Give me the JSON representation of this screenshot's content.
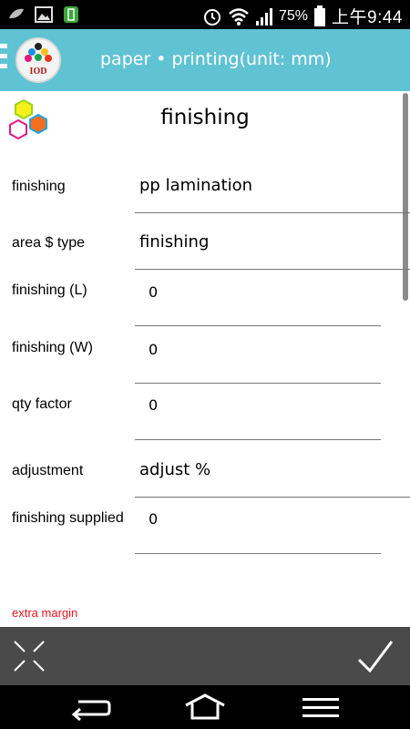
{
  "statusbar": {
    "battery_pct": "75%",
    "time": "上午9:44",
    "icons": [
      "leaf-icon",
      "image-icon",
      "battery-app-icon",
      "alarm-icon",
      "wifi-icon",
      "signal-icon",
      "battery-icon"
    ]
  },
  "appbar": {
    "logo_text": "IOD",
    "title": "paper • printing(unit: mm)"
  },
  "page": {
    "title": "finishing"
  },
  "form": {
    "finishing": {
      "label": "finishing",
      "value": "pp lamination"
    },
    "area_type": {
      "label": "area $ type",
      "value": "finishing"
    },
    "finishing_l": {
      "label": "finishing (L)",
      "value": "0"
    },
    "finishing_w": {
      "label": "finishing (W)",
      "value": "0"
    },
    "qty_factor": {
      "label": "qty factor",
      "value": "0"
    },
    "adjustment": {
      "label": "adjustment",
      "value": "adjust %"
    },
    "finishing_supplied": {
      "label": "finishing supplied",
      "value": "0"
    },
    "extra_margin": "extra margin"
  },
  "colors": {
    "appbar": "#5fc3d3",
    "actionbar": "#4a4a4a",
    "extra_margin": "#e8141c"
  }
}
